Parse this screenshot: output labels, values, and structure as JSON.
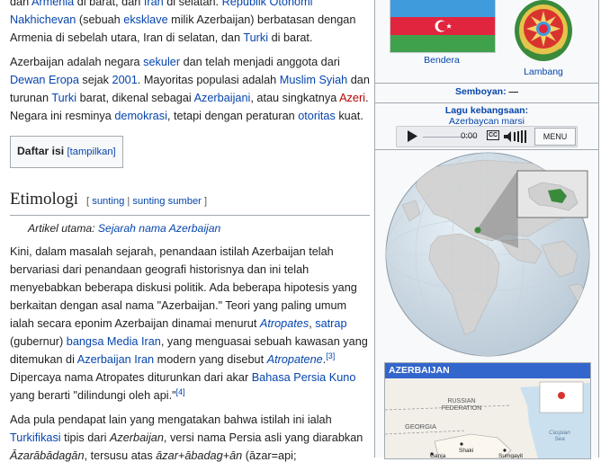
{
  "article": {
    "p1_parts": [
      "dan ",
      "Armenia",
      " di barat, dan ",
      "Iran",
      " di selatan. ",
      "Republik Otonomi Nakhichevan",
      " (sebuah ",
      "eksklave",
      " milik Azerbaijan) berbatasan dengan Armenia di sebelah utara, Iran di selatan, dan ",
      "Turki",
      " di barat."
    ],
    "p2_parts": [
      "Azerbaijan adalah negara ",
      "sekuler",
      " dan telah menjadi anggota dari ",
      "Dewan Eropa",
      " sejak ",
      "2001",
      ". Mayoritas populasi adalah ",
      "Muslim Syiah",
      " dan turunan ",
      "Turki",
      " barat, dikenal sebagai ",
      "Azerbaijani",
      ", atau singkatnya ",
      "Azeri",
      ". Negara ini resminya ",
      "demokrasi",
      ", tetapi dengan peraturan ",
      "otoritas",
      " kuat."
    ],
    "toc": {
      "title": "Daftar isi",
      "toggle": "[tampilkan]"
    },
    "section": {
      "heading": "Etimologi",
      "edit_open": "[ ",
      "edit_link": "sunting",
      "edit_sep": " | ",
      "edit_source": "sunting sumber",
      "edit_close": " ]"
    },
    "hatnote": {
      "prefix": "Artikel utama: ",
      "link": "Sejarah nama Azerbaijan"
    },
    "p3_parts": [
      "Kini, dalam masalah sejarah, penandaan istilah Azerbaijan telah bervariasi dari penandaan geografi historisnya dan ini telah menyebabkan beberapa diskusi politik. Ada beberapa hipotesis yang berkaitan dengan asal nama \"Azerbaijan.\" Teori yang paling umum ialah secara eponim Azerbaijan dinamai menurut ",
      "Atropates",
      ", ",
      "satrap",
      " (gubernur) ",
      "bangsa Media Iran",
      ", yang menguasai sebuah kawasan yang ditemukan di ",
      "Azerbaijan Iran",
      " modern yang disebut ",
      "Atropatene",
      ".",
      "[3]",
      " Dipercaya nama Atropates diturunkan dari akar ",
      "Bahasa Persia Kuno",
      " yang berarti \"dilindungi oleh api.\"",
      "[4]"
    ],
    "p4_parts": [
      "Ada pula pendapat lain yang mengatakan bahwa istilah ini ialah ",
      "Turkifikasi",
      " tipis dari ",
      "Azerbaijan",
      ", versi nama Persia asli yang diarabkan ",
      "Āzarābādagān",
      ", tersusu atas ",
      "āzar+ābadag+ān",
      " (āzar=api;"
    ]
  },
  "infobox": {
    "flag_caption": "Bendera",
    "emblem_caption": "Lambang",
    "motto_label": "Semboyan:",
    "motto_value": " —",
    "anthem_label": "Lagu kebangsaan:",
    "anthem_value": "Azerbaycan marsi",
    "player": {
      "time": "0:00",
      "cc": "CC",
      "menu": "MENU"
    },
    "map_title": "AZERBAIJAN",
    "map_labels": {
      "russia": "RUSSIAN FEDERATION",
      "georgia": "GEORGIA",
      "caspian": "Caspian Sea",
      "shaki": "Shaki",
      "ganja": "Ganja",
      "sumgayit": "Sumgayit"
    }
  },
  "colors": {
    "link": "#0645ad",
    "flag_blue": "#3f9bdb",
    "flag_red": "#e2253e",
    "flag_green": "#3fa14c",
    "map_header": "#3366cc"
  }
}
